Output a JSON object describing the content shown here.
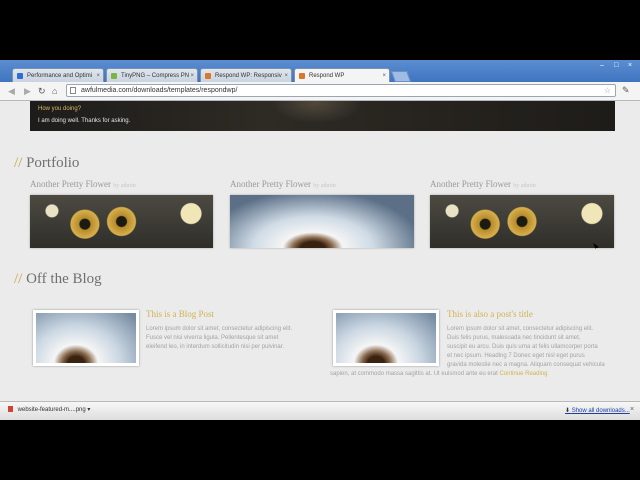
{
  "browser": {
    "tabs": [
      {
        "title": "Performance and Optimi",
        "fav_color": "#2b6fd6",
        "active": false
      },
      {
        "title": "TinyPNG – Compress PN",
        "fav_color": "#7ab541",
        "active": false
      },
      {
        "title": "Respond WP: Responsiv",
        "fav_color": "#d8782a",
        "active": false
      },
      {
        "title": "Respond WP",
        "fav_color": "#d8782a",
        "active": true
      }
    ],
    "url": "awfulmedia.com/downloads/templates/respondwp/"
  },
  "page": {
    "header_bar": {
      "question": "How you doing?",
      "answer": "I am doing well. Thanks for asking."
    },
    "portfolio": {
      "slashes": "//",
      "heading": "Portfolio",
      "items": [
        {
          "title": "Another Pretty Flower",
          "by": "by admin",
          "image": "flowers"
        },
        {
          "title": "Another Pretty Flower",
          "by": "by admin",
          "image": "dandelion"
        },
        {
          "title": "Another Pretty Flower",
          "by": "by admin",
          "image": "flowers"
        }
      ]
    },
    "blog": {
      "slashes": "//",
      "heading": "Off the Blog",
      "posts": [
        {
          "title": "This is a Blog Post",
          "lines": [
            "Lorem ipsum dolor sit amet, consectetur adipiscing elit.",
            "Fusce vel nisi viverra ligula. Pellentesque sit amet",
            "eleifend leo, in interdum sollicitudin nisi per pulvinar."
          ]
        },
        {
          "title": "This is also a post's title",
          "lines": [
            "Lorem ipsum dolor sit amet, consectetur adipiscing elit.",
            "Duis felis purus, malesuada nec tincidunt sit amet,",
            "suscipit eu arcu. Duis quis urna at felis ullamcorper porta",
            "et nec ipsum. Heading 7 Donec eget nisl eget purus",
            "gravida molestie nec a magna. Aliquam consequat vehicula",
            "sapien, at commodo massa sagittis at. Ut euismod ante eu erat"
          ],
          "continue": "Continue Reading"
        }
      ]
    }
  },
  "downloads": {
    "item": "website-featured-m....png",
    "show_all": "Show all downloads..."
  },
  "colors": {
    "accent": "#d1b253",
    "heading": "#6f6f6f"
  }
}
